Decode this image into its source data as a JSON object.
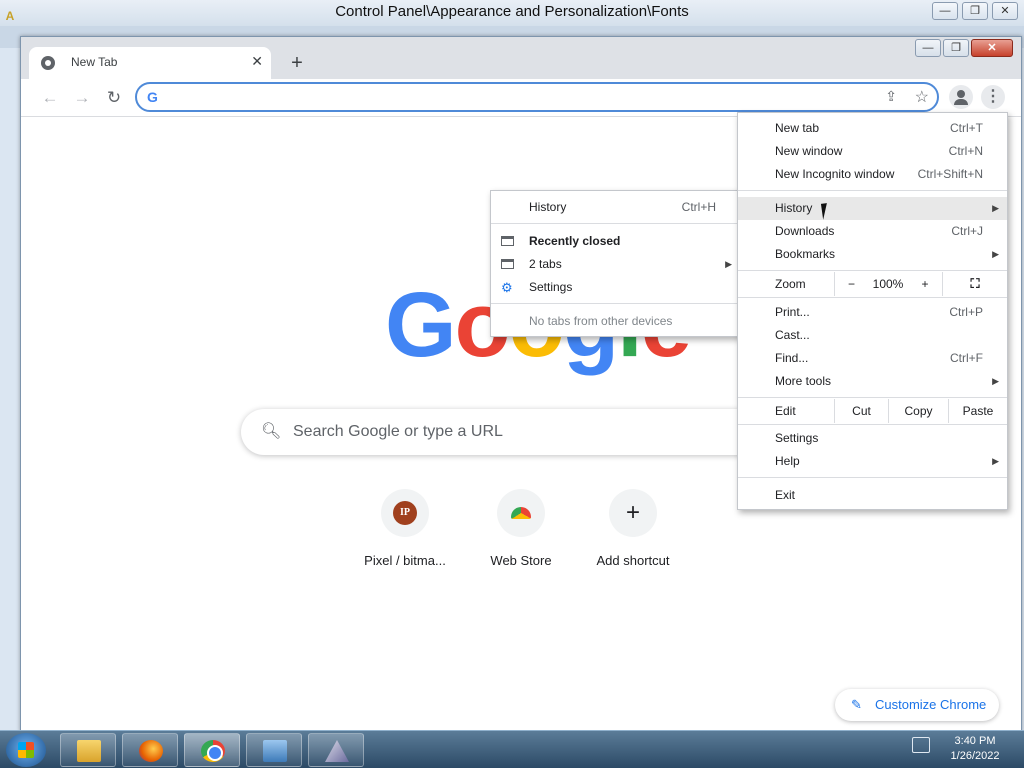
{
  "background_window": {
    "title": "Control Panel\\Appearance and Personalization\\Fonts"
  },
  "tab": {
    "title": "New Tab",
    "close": "✕"
  },
  "toolbar": {
    "new_tab": "+"
  },
  "new_tab_page": {
    "logo": [
      "G",
      "o",
      "o",
      "g",
      "l",
      "e"
    ],
    "search_placeholder": "Search Google or type a URL",
    "shortcuts": [
      {
        "label": "Pixel / bitma...",
        "icon": "pixel-bitmap-icon",
        "badge": "IP"
      },
      {
        "label": "Web Store",
        "icon": "web-store-icon"
      },
      {
        "label": "Add shortcut",
        "icon": "plus-icon",
        "glyph": "+"
      }
    ],
    "customize_label": "Customize Chrome"
  },
  "chrome_menu": {
    "items": [
      {
        "label": "New tab",
        "shortcut": "Ctrl+T"
      },
      {
        "label": "New window",
        "shortcut": "Ctrl+N"
      },
      {
        "label": "New Incognito window",
        "shortcut": "Ctrl+Shift+N"
      },
      {
        "label": "History",
        "has_submenu": true,
        "highlighted": true
      },
      {
        "label": "Downloads",
        "shortcut": "Ctrl+J"
      },
      {
        "label": "Bookmarks",
        "has_submenu": true
      },
      {
        "label": "Print...",
        "shortcut": "Ctrl+P"
      },
      {
        "label": "Cast..."
      },
      {
        "label": "Find...",
        "shortcut": "Ctrl+F"
      },
      {
        "label": "More tools",
        "has_submenu": true
      },
      {
        "label": "Settings"
      },
      {
        "label": "Help",
        "has_submenu": true
      },
      {
        "label": "Exit"
      }
    ],
    "zoom": {
      "label": "Zoom",
      "minus": "−",
      "value": "100%",
      "plus": "+"
    },
    "edit": {
      "label": "Edit",
      "cut": "Cut",
      "copy": "Copy",
      "paste": "Paste"
    }
  },
  "history_submenu": {
    "history": {
      "label": "History",
      "shortcut": "Ctrl+H"
    },
    "recently_closed": "Recently closed",
    "two_tabs": "2 tabs",
    "settings": "Settings",
    "no_tabs": "No tabs from other devices"
  },
  "taskbar": {
    "apps": [
      "Windows Explorer",
      "Firefox",
      "Google Chrome",
      "Control Panel",
      "Application"
    ],
    "clock_time": "3:40 PM",
    "clock_date": "1/26/2022"
  }
}
